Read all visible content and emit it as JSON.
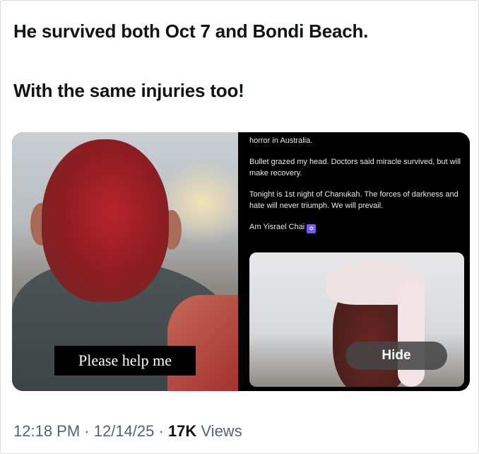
{
  "post": {
    "line1": "He survived both Oct 7 and Bondi Beach.",
    "line2": "With the same injuries too!"
  },
  "media": {
    "left_caption": "Please help me",
    "right_text": {
      "p1": "horror in Australia.",
      "p2": "Bullet grazed my head. Doctors said miracle survived, but will make recovery.",
      "p3": "Tonight is 1st night of Chanukah. The forces of darkness and hate will never triumph. We will prevail.",
      "p4": "Am Yisrael Chai",
      "emoji": "✡"
    },
    "hide_label": "Hide"
  },
  "meta": {
    "time": "12:18 PM",
    "sep1": " · ",
    "date": "12/14/25",
    "sep2": " · ",
    "views_count": "17K",
    "views_label": " Views"
  }
}
